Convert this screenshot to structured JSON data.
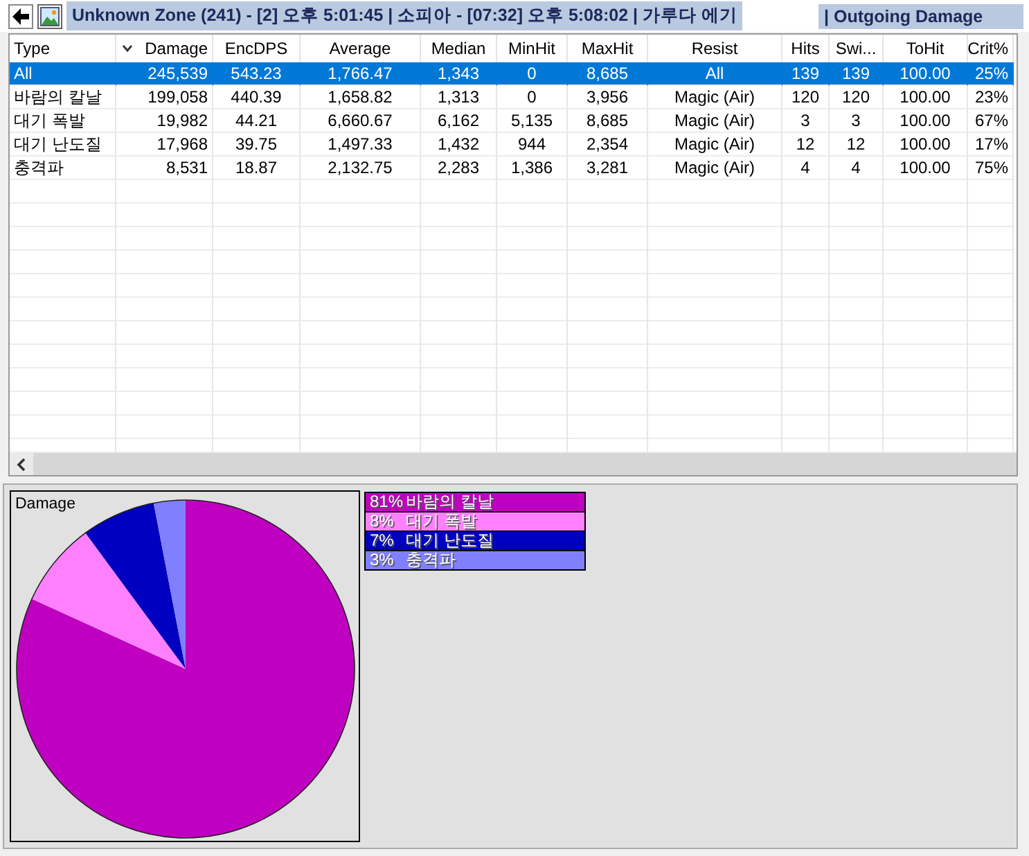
{
  "toolbar": {
    "zone_title": "Unknown Zone (241) - [2] 오후 5:01:45  | 소피아 - [07:32] 오후 5:08:02  | 가루다 에기",
    "view_title": "| Outgoing Damage"
  },
  "table": {
    "columns": [
      {
        "label": "Type",
        "sorted": false
      },
      {
        "label": "Damage",
        "sorted": true
      },
      {
        "label": "EncDPS",
        "sorted": false
      },
      {
        "label": "Average",
        "sorted": false
      },
      {
        "label": "Median",
        "sorted": false
      },
      {
        "label": "MinHit",
        "sorted": false
      },
      {
        "label": "MaxHit",
        "sorted": false
      },
      {
        "label": "Resist",
        "sorted": false
      },
      {
        "label": "Hits",
        "sorted": false
      },
      {
        "label": "Swi...",
        "sorted": false
      },
      {
        "label": "ToHit",
        "sorted": false
      },
      {
        "label": "Crit%",
        "sorted": false
      }
    ],
    "rows": [
      {
        "selected": true,
        "cells": [
          "All",
          "245,539",
          "543.23",
          "1,766.47",
          "1,343",
          "0",
          "8,685",
          "All",
          "139",
          "139",
          "100.00",
          "25%"
        ]
      },
      {
        "selected": false,
        "cells": [
          "바람의 칼날",
          "199,058",
          "440.39",
          "1,658.82",
          "1,313",
          "0",
          "3,956",
          "Magic (Air)",
          "120",
          "120",
          "100.00",
          "23%"
        ]
      },
      {
        "selected": false,
        "cells": [
          "대기 폭발",
          "19,982",
          "44.21",
          "6,660.67",
          "6,162",
          "5,135",
          "8,685",
          "Magic (Air)",
          "3",
          "3",
          "100.00",
          "67%"
        ]
      },
      {
        "selected": false,
        "cells": [
          "대기 난도질",
          "17,968",
          "39.75",
          "1,497.33",
          "1,432",
          "944",
          "2,354",
          "Magic (Air)",
          "12",
          "12",
          "100.00",
          "17%"
        ]
      },
      {
        "selected": false,
        "cells": [
          "충격파",
          "8,531",
          "18.87",
          "2,132.75",
          "2,283",
          "1,386",
          "3,281",
          "Magic (Air)",
          "4",
          "4",
          "100.00",
          "75%"
        ]
      }
    ]
  },
  "chart": {
    "chart_data": {
      "type": "pie",
      "categories": [
        "바람의 칼날",
        "대기 폭발",
        "대기 난도질",
        "충격파"
      ],
      "series": [
        {
          "name": "Damage",
          "values": [
            81,
            8,
            7,
            3
          ]
        }
      ]
    },
    "legend": [
      {
        "percent": "81%",
        "color": "#c000c0"
      },
      {
        "percent": "8%",
        "color": "#ff80ff"
      },
      {
        "percent": "7%",
        "color": "#0000c0"
      },
      {
        "percent": "3%",
        "color": "#8080ff"
      }
    ]
  }
}
